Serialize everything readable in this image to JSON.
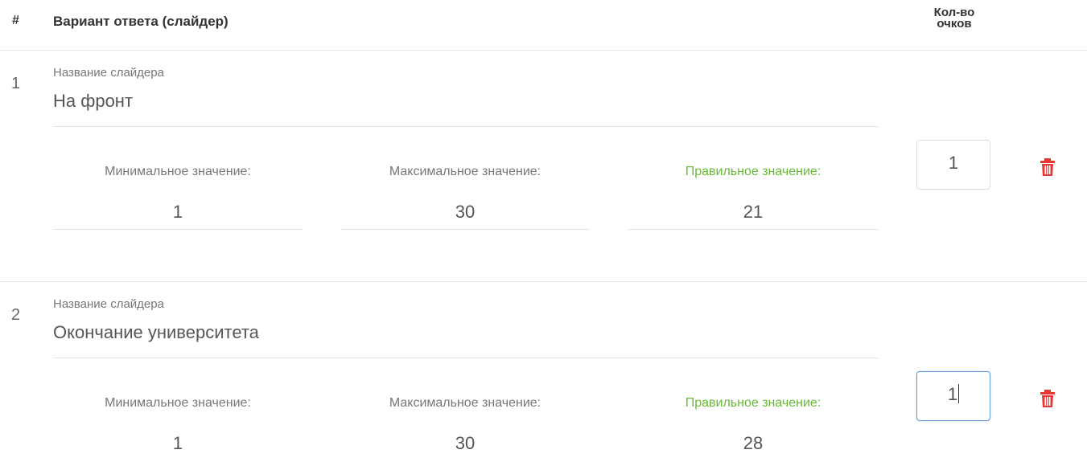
{
  "header": {
    "number_label": "#",
    "variant_label": "Вариант ответа (слайдер)",
    "points_label_line1": "Кол-во",
    "points_label_line2": "очков"
  },
  "rows": [
    {
      "number": "1",
      "name_label": "Название слайдера",
      "name_value": "На фронт",
      "min_label": "Минимальное значение:",
      "min_value": "1",
      "max_label": "Максимальное значение:",
      "max_value": "30",
      "correct_label": "Правильное значение:",
      "correct_value": "21",
      "points": "1",
      "focused": false
    },
    {
      "number": "2",
      "name_label": "Название слайдера",
      "name_value": "Окончание университета",
      "min_label": "Минимальное значение:",
      "min_value": "1",
      "max_label": "Максимальное значение:",
      "max_value": "30",
      "correct_label": "Правильное значение:",
      "correct_value": "28",
      "points": "1",
      "focused": true
    }
  ],
  "colors": {
    "correct_label": "#66bb33",
    "delete_icon": "#e53935",
    "focus_border": "#6699dd"
  },
  "icons": {
    "delete": "trash-icon"
  }
}
